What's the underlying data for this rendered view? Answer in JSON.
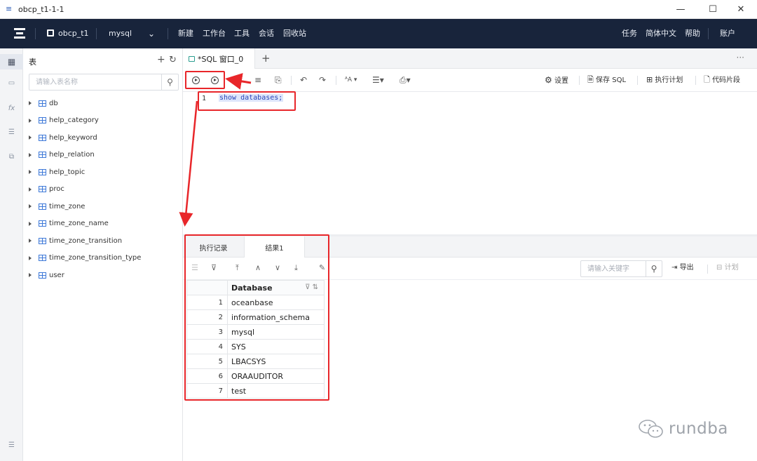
{
  "window": {
    "title": "obcp_t1-1-1",
    "minimize": "—",
    "maximize": "☐",
    "close": "✕"
  },
  "navbar": {
    "connection": "obcp_t1",
    "database": "mysql",
    "menu": [
      "新建",
      "工作台",
      "工具",
      "会话",
      "回收站"
    ],
    "right": [
      "任务",
      "简体中文",
      "帮助",
      "账户"
    ]
  },
  "tree": {
    "header": "表",
    "search_placeholder": "请输入表名称",
    "tables": [
      "db",
      "help_category",
      "help_keyword",
      "help_relation",
      "help_topic",
      "proc",
      "time_zone",
      "time_zone_name",
      "time_zone_transition",
      "time_zone_transition_type",
      "user"
    ]
  },
  "editor": {
    "tab_label": "*SQL 窗口_0",
    "toolbar": {
      "settings": "设置",
      "save_sql": "保存 SQL",
      "exec_plan": "执行计划",
      "snippet": "代码片段"
    },
    "line_number": "1",
    "code": "show databases;"
  },
  "results": {
    "tabs": [
      "执行记录",
      "结果1"
    ],
    "active_tab": 1,
    "search_placeholder": "请输入关键字",
    "export": "导出",
    "plan": "计划",
    "column": "Database",
    "rows": [
      {
        "n": "1",
        "v": "oceanbase"
      },
      {
        "n": "2",
        "v": "information_schema"
      },
      {
        "n": "3",
        "v": "mysql"
      },
      {
        "n": "4",
        "v": "SYS"
      },
      {
        "n": "5",
        "v": "LBACSYS"
      },
      {
        "n": "6",
        "v": "ORAAUDITOR"
      },
      {
        "n": "7",
        "v": "test"
      }
    ]
  },
  "watermark": "rundba",
  "colors": {
    "nav": "#18243b",
    "accent": "#3d78d8",
    "annotation": "#e8262a"
  }
}
